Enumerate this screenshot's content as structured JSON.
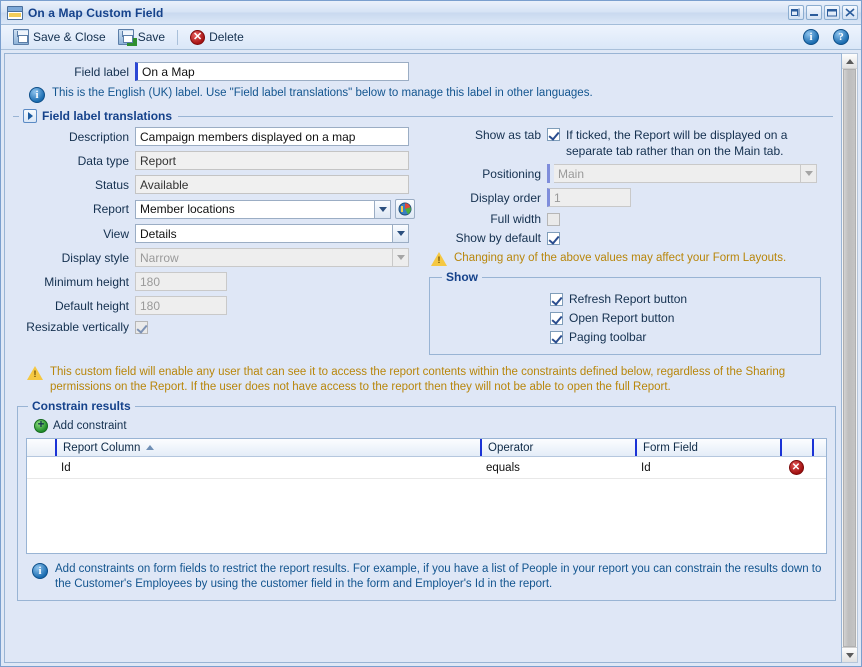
{
  "window": {
    "title": "On a Map Custom Field",
    "icon": "form-window-icon",
    "buttons": [
      {
        "name": "restore-down-button",
        "glyph": "pin"
      },
      {
        "name": "minimize-button",
        "glyph": "minimize"
      },
      {
        "name": "maximize-button",
        "glyph": "maximize"
      },
      {
        "name": "close-button",
        "glyph": "close"
      }
    ]
  },
  "toolbar": {
    "save_close_label": "Save & Close",
    "save_label": "Save",
    "delete_label": "Delete",
    "info_glyph": "i",
    "help_glyph": "?"
  },
  "field_label": {
    "label": "Field label",
    "value": "On a Map",
    "note": "This is the English (UK) label. Use \"Field label translations\" below to manage this label in other languages."
  },
  "translations_section": {
    "legend": "Field label translations",
    "expanded": false
  },
  "left_form": {
    "description": {
      "label": "Description",
      "value": "Campaign members displayed on a map"
    },
    "data_type": {
      "label": "Data type",
      "value": "Report"
    },
    "status": {
      "label": "Status",
      "value": "Available"
    },
    "report": {
      "label": "Report",
      "value": "Member locations"
    },
    "view": {
      "label": "View",
      "value": "Details"
    },
    "display_style": {
      "label": "Display style",
      "value": "Narrow"
    },
    "minimum_height": {
      "label": "Minimum height",
      "value": "180"
    },
    "default_height": {
      "label": "Default height",
      "value": "180"
    },
    "resizable": {
      "label": "Resizable vertically",
      "checked": true
    }
  },
  "right_form": {
    "show_as_tab": {
      "label": "Show as tab",
      "checked": true,
      "hint_line1": "If ticked, the Report will be displayed on a",
      "hint_line2": "separate tab rather than on the Main tab."
    },
    "positioning": {
      "label": "Positioning",
      "value": "Main"
    },
    "display_order": {
      "label": "Display order",
      "value": "1"
    },
    "full_width": {
      "label": "Full width",
      "checked": false
    },
    "show_by_default": {
      "label": "Show by default",
      "checked": true
    },
    "layout_warning": "Changing any of the above values may affect your Form Layouts.",
    "show_group": {
      "legend": "Show",
      "options": [
        {
          "label": "Refresh Report button",
          "checked": true
        },
        {
          "label": "Open Report button",
          "checked": true
        },
        {
          "label": "Paging toolbar",
          "checked": true
        }
      ]
    }
  },
  "permissions_warning": {
    "line1": "This custom field will enable any user that can see it to access the report contents within the constraints defined below, regardless of the Sharing permissions",
    "line2": "on the Report. If the user does not have access to the report then they will not be able to open the full Report."
  },
  "constrain_results": {
    "legend": "Constrain results",
    "add_label": "Add constraint",
    "columns": [
      "",
      "Report Column",
      "Operator",
      "Form Field",
      "",
      ""
    ],
    "sorted_column": "Report Column",
    "sort_direction": "asc",
    "rows": [
      {
        "report_column": "Id",
        "operator": "equals",
        "form_field": "Id",
        "delete_glyph": "✕"
      }
    ],
    "footer_note_line1": "Add constraints on form fields to restrict the report results. For example, if you have a list of People in your report you can constrain the results down to the",
    "footer_note_line2": "Customer's Employees by using the customer field in the form and Employer's Id in the report."
  },
  "colors": {
    "window_bg": "#dfe7f6",
    "title_text": "#15428b",
    "accent_blue": "#1b33d6",
    "warn_text": "#b8860b",
    "info_text": "#13558f"
  }
}
